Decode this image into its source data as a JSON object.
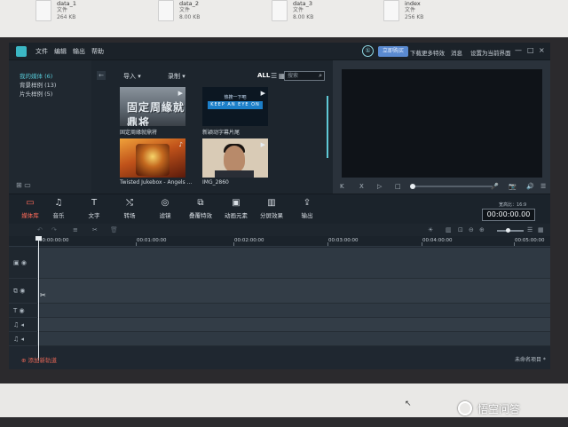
{
  "desktop": {
    "files": [
      {
        "name": "data_1",
        "type": "文件",
        "size": "264 KB"
      },
      {
        "name": "data_2",
        "type": "文件",
        "size": "8.00 KB"
      },
      {
        "name": "data_3",
        "type": "文件",
        "size": "8.00 KB"
      },
      {
        "name": "index",
        "type": "文件",
        "size": "256 KB"
      }
    ]
  },
  "menubar": {
    "items": [
      "文件",
      "编辑",
      "输出",
      "帮助"
    ],
    "buy_label": "立即购买",
    "links": [
      "下载更多特效",
      "消息",
      "设置为当前界面"
    ],
    "window_controls": [
      "—",
      "□",
      "×"
    ]
  },
  "library": {
    "nav": [
      {
        "label": "我的媒体 (6)",
        "active": true
      },
      {
        "label": "背景样例 (13)",
        "active": false
      },
      {
        "label": "片头样例 (5)",
        "active": false
      }
    ],
    "import_label": "导入 ▾",
    "record_label": "录制 ▾",
    "all_label": "ALL",
    "search_placeholder": "搜索",
    "items": [
      {
        "title_text": "固定周緣就鼎将",
        "caption": "固定周緣就鼎将"
      },
      {
        "top_text": "热搜一下吧",
        "keep_text": "KEEP AN EYE ON",
        "caption": "新颖动字幕片尾"
      },
      {
        "caption": "Twisted Jukebox - Angels ..."
      },
      {
        "caption": "IMG_2860"
      }
    ]
  },
  "preview": {
    "controls": [
      "K",
      "X",
      "▷",
      "□"
    ],
    "right_controls": [
      "🎤",
      "📷",
      "🔊",
      "☰"
    ]
  },
  "toolbar": {
    "tools": [
      {
        "icon": "▭",
        "label": "媒体库",
        "active": true
      },
      {
        "icon": "♫",
        "label": "音乐",
        "active": false
      },
      {
        "icon": "T",
        "label": "文字",
        "active": false
      },
      {
        "icon": "⤭",
        "label": "转场",
        "active": false
      },
      {
        "icon": "◎",
        "label": "滤镜",
        "active": false
      },
      {
        "icon": "⧉",
        "label": "叠覆特效",
        "active": false
      },
      {
        "icon": "▣",
        "label": "动画元素",
        "active": false
      },
      {
        "icon": "▥",
        "label": "分屏效果",
        "active": false
      },
      {
        "icon": "⇪",
        "label": "输出",
        "active": false
      }
    ],
    "ratio": "宽高比：16:9",
    "timecode": "00:00:00.00"
  },
  "timeline": {
    "ticks": [
      "00:00:00:00",
      "00:01:00:00",
      "00:02:00:00",
      "00:03:00:00",
      "00:04:00:00",
      "00:05:00:00"
    ],
    "add_track_label": "添加新轨道",
    "project_name": "未命名项目 *"
  },
  "watermark": "悟空问答"
}
